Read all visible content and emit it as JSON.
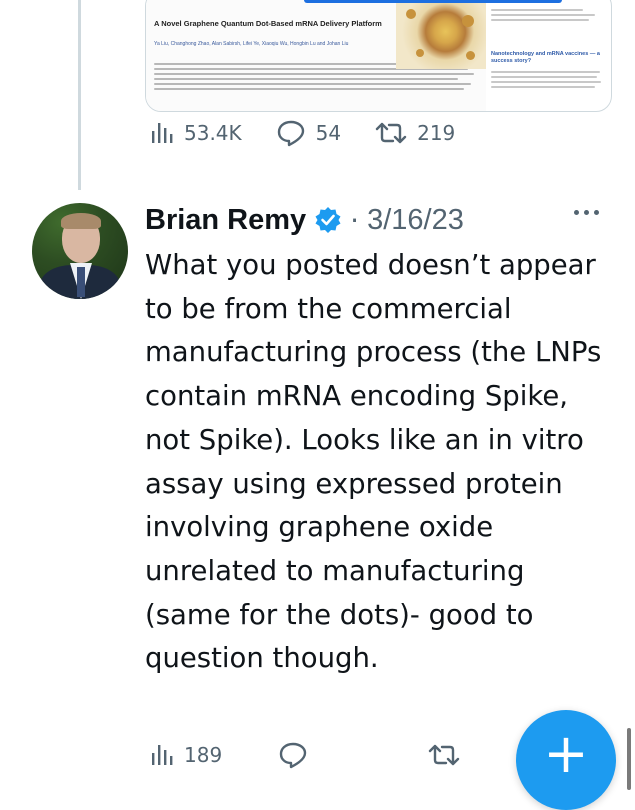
{
  "prev_tweet": {
    "media": {
      "paper_title": "A Novel Graphene Quantum Dot-Based mRNA Delivery Platform",
      "paper_authors": "Ya Liu, Changhong Zhao, Alan Sabirsh, Lifei Ye, Xiaoqiu Wu, Hongbin Lu and Johan Liu",
      "section_heading": "Nanotechnology and mRNA vaccines — a success story?"
    },
    "stats": {
      "views": "53.4K",
      "replies": "54",
      "retweets": "219"
    }
  },
  "tweet": {
    "author_name": "Brian Remy",
    "separator": "·",
    "date": "3/16/23",
    "text": "What you posted doesn’t appear to be from the commercial manufacturing process (the LNPs contain mRNA encoding Spike, not Spike). Looks like an in vitro assay using expressed protein involving graphene oxide unrelated to manufacturing (same for the dots)- good to question though.",
    "stats": {
      "views": "189",
      "replies": "",
      "retweets": ""
    }
  },
  "compose_button": {
    "symbol": "+"
  },
  "colors": {
    "accent": "#1d9bf0",
    "muted": "#536471",
    "text": "#0f1419"
  },
  "icons": [
    "views-icon",
    "reply-icon",
    "retweet-icon",
    "verified-icon",
    "more-icon",
    "compose-icon"
  ]
}
